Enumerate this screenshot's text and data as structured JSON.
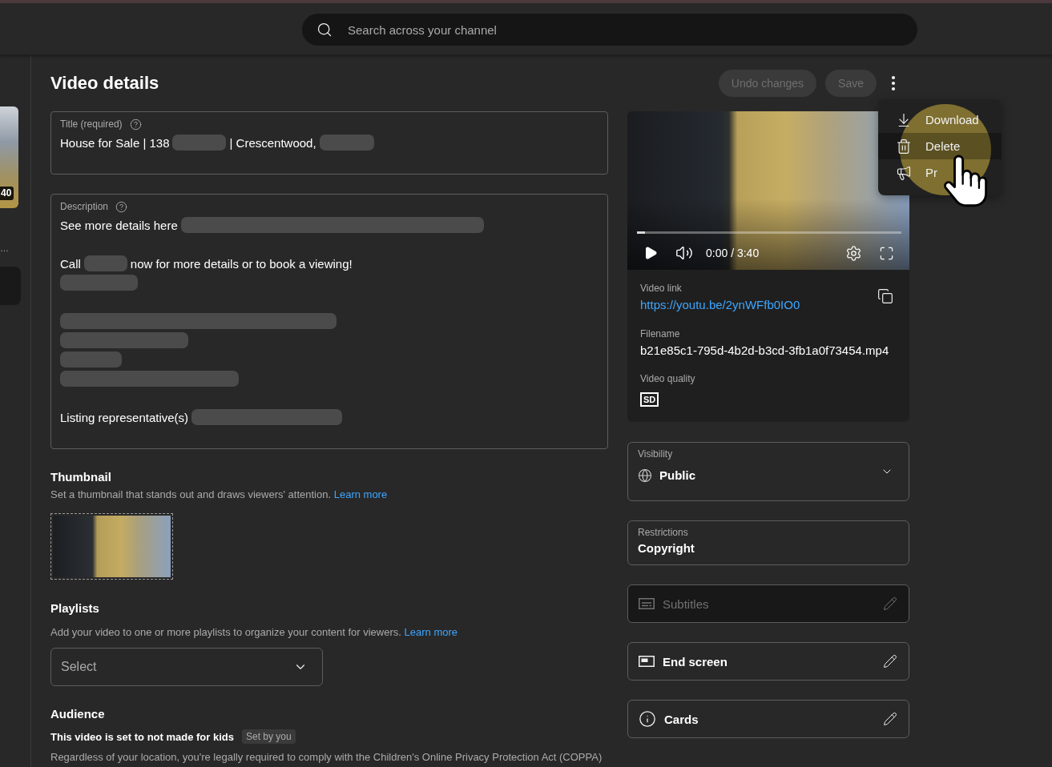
{
  "search": {
    "placeholder": "Search across your channel"
  },
  "sidebar": {
    "thumbnail_badge": "40",
    "title_fragment": "…",
    "nav_item": {
      "selected": true
    }
  },
  "header": {
    "title": "Video details",
    "actions": [
      {
        "label": "Undo changes",
        "disabled": true
      },
      {
        "label": "Save",
        "disabled": true
      }
    ],
    "more_menu": {
      "open": true,
      "items": [
        {
          "kind": "download",
          "label": "Download",
          "highlighted": false
        },
        {
          "kind": "delete",
          "label": "Delete",
          "highlighted": true
        },
        {
          "kind": "promote",
          "label": "Pr",
          "highlighted": false
        }
      ]
    }
  },
  "title_field": {
    "label": "Title (required)",
    "value": [
      {
        "kind": "text",
        "text": "House for Sale | 138"
      },
      {
        "kind": "redacted"
      },
      {
        "kind": "text",
        "text": "| Crescentwood,"
      },
      {
        "kind": "redacted"
      }
    ]
  },
  "description_field": {
    "label": "Description",
    "lines": [
      {
        "kind": "line",
        "segments": [
          {
            "kind": "text",
            "text": "See more details here"
          },
          {
            "kind": "redacted"
          }
        ]
      },
      {
        "kind": "blank"
      },
      {
        "kind": "line",
        "segments": [
          {
            "kind": "text",
            "text": "Call"
          },
          {
            "kind": "redacted"
          },
          {
            "kind": "text",
            "text": "now for more details or to book a viewing!"
          }
        ]
      },
      {
        "kind": "line",
        "segments": [
          {
            "kind": "redacted"
          }
        ]
      },
      {
        "kind": "blank"
      },
      {
        "kind": "line",
        "segments": [
          {
            "kind": "redacted"
          }
        ]
      },
      {
        "kind": "line",
        "segments": [
          {
            "kind": "redacted"
          }
        ]
      },
      {
        "kind": "line",
        "segments": [
          {
            "kind": "redacted"
          }
        ]
      },
      {
        "kind": "line",
        "segments": [
          {
            "kind": "redacted"
          }
        ]
      },
      {
        "kind": "blank"
      },
      {
        "kind": "line",
        "segments": [
          {
            "kind": "text",
            "text": "Listing representative(s)"
          },
          {
            "kind": "redacted"
          }
        ]
      }
    ]
  },
  "thumbnail": {
    "heading": "Thumbnail",
    "description": "Set a thumbnail that stands out and draws viewers' attention.",
    "link": "Learn more"
  },
  "playlists": {
    "heading": "Playlists",
    "description": "Add your video to one or more playlists to organize your content for viewers.",
    "link": "Learn more",
    "select": {
      "placeholder": "Select"
    }
  },
  "audience": {
    "heading": "Audience",
    "status": "This video is set to not made for kids",
    "tag": "Set by you",
    "note": "Regardless of your location, you're legally required to comply with the Children's Online Privacy Protection Act (COPPA)"
  },
  "video": {
    "player": {
      "playing": false,
      "progress": {
        "level": 0.03
      },
      "time": "0:00 / 3:40"
    },
    "link_label": "Video link",
    "link": "https://youtu.be/2ynWFfb0IO0",
    "filename_label": "Filename",
    "filename": "b21e85c1-795d-4b2d-b3cd-3fb1a0f73454.mp4",
    "quality_label": "Video quality",
    "quality": "SD"
  },
  "settings_cards": [
    {
      "kind": "visibility",
      "label": "Visibility",
      "value": "Public"
    },
    {
      "kind": "restrictions",
      "label": "Restrictions",
      "value": "Copyright"
    },
    {
      "kind": "subtitles",
      "label": "Subtitles",
      "disabled": true
    },
    {
      "kind": "endscreen",
      "label": "End screen",
      "disabled": false
    },
    {
      "kind": "cards",
      "label": "Cards",
      "disabled": false
    }
  ]
}
